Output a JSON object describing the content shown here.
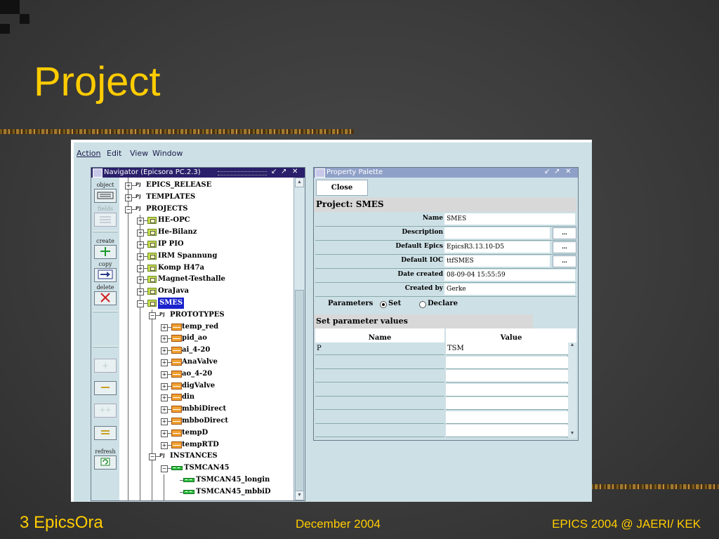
{
  "slide": {
    "title": "Project",
    "footer_left": "3 EpicsOra",
    "footer_center": "December 2004",
    "footer_right": "EPICS 2004 @ JAERI/ KEK"
  },
  "menu": [
    "Action",
    "Edit",
    "View",
    "Window"
  ],
  "navigator": {
    "title": "Navigator  (Epicsora PC.2.3)",
    "toolbar": [
      {
        "label": "object",
        "icon": "object-icon",
        "enabled": true
      },
      {
        "label": "fields",
        "icon": "fields-icon",
        "enabled": false
      },
      {
        "label": "create",
        "icon": "plus-icon",
        "enabled": true
      },
      {
        "label": "copy",
        "icon": "copy-arrow-icon",
        "enabled": true
      },
      {
        "label": "delete",
        "icon": "delete-x-icon",
        "enabled": true
      },
      {
        "label": "",
        "icon": "expand-icon",
        "enabled": false
      },
      {
        "label": "",
        "icon": "collapse-icon",
        "enabled": true
      },
      {
        "label": "",
        "icon": "expand-all-icon",
        "enabled": false
      },
      {
        "label": "",
        "icon": "collapse-all-icon",
        "enabled": true
      },
      {
        "label": "refresh",
        "icon": "refresh-icon",
        "enabled": true
      }
    ],
    "tree": [
      {
        "label": "EPICS_RELEASE",
        "icon": "pj",
        "level": 0,
        "toggle": "+"
      },
      {
        "label": "TEMPLATES",
        "icon": "pj",
        "level": 0,
        "toggle": "+"
      },
      {
        "label": "PROJECTS",
        "icon": "pj",
        "level": 0,
        "toggle": "-"
      },
      {
        "label": "HE-OPC",
        "icon": "project",
        "level": 1,
        "toggle": "+"
      },
      {
        "label": "He-Bilanz",
        "icon": "project",
        "level": 1,
        "toggle": "+"
      },
      {
        "label": "IP PIO",
        "icon": "project",
        "level": 1,
        "toggle": "+"
      },
      {
        "label": "IRM Spannung",
        "icon": "project",
        "level": 1,
        "toggle": "+"
      },
      {
        "label": "Komp H47a",
        "icon": "project",
        "level": 1,
        "toggle": "+"
      },
      {
        "label": "Magnet-Testhalle",
        "icon": "project",
        "level": 1,
        "toggle": "+"
      },
      {
        "label": "OraJava",
        "icon": "project",
        "level": 1,
        "toggle": "+"
      },
      {
        "label": "SMES",
        "icon": "project",
        "level": 1,
        "toggle": "-",
        "selected": true
      },
      {
        "label": "PROTOTYPES",
        "icon": "pj",
        "level": 2,
        "toggle": "-"
      },
      {
        "label": "temp_red",
        "icon": "record",
        "level": 3,
        "toggle": "+"
      },
      {
        "label": "pid_ao",
        "icon": "record",
        "level": 3,
        "toggle": "+"
      },
      {
        "label": "ai_4-20",
        "icon": "record",
        "level": 3,
        "toggle": "+"
      },
      {
        "label": "AnaValve",
        "icon": "record",
        "level": 3,
        "toggle": "+"
      },
      {
        "label": "ao_4-20",
        "icon": "record",
        "level": 3,
        "toggle": "+"
      },
      {
        "label": "digValve",
        "icon": "record",
        "level": 3,
        "toggle": "+"
      },
      {
        "label": "din",
        "icon": "record",
        "level": 3,
        "toggle": "+"
      },
      {
        "label": "mbbiDirect",
        "icon": "record",
        "level": 3,
        "toggle": "+"
      },
      {
        "label": "mbboDirect",
        "icon": "record",
        "level": 3,
        "toggle": "+"
      },
      {
        "label": "tempD",
        "icon": "record",
        "level": 3,
        "toggle": "+"
      },
      {
        "label": "tempRTD",
        "icon": "record",
        "level": 3,
        "toggle": "+"
      },
      {
        "label": "INSTANCES",
        "icon": "pj",
        "level": 2,
        "toggle": "-"
      },
      {
        "label": "TSMCAN45",
        "icon": "instance",
        "level": 3,
        "toggle": "-"
      },
      {
        "label": "TSMCAN45_longin",
        "icon": "instance",
        "level": 4,
        "toggle": ""
      },
      {
        "label": "TSMCAN45_mbbiD",
        "icon": "instance",
        "level": 4,
        "toggle": ""
      }
    ]
  },
  "palette": {
    "title": "Property Palette",
    "close_label": "Close",
    "project_header": "Project:  SMES",
    "properties": [
      {
        "name": "Name",
        "value": "SMES",
        "button": ""
      },
      {
        "name": "Description",
        "value": "",
        "button": "..."
      },
      {
        "name": "Default Epics",
        "value": "EpicsR3.13.10-D5",
        "button": "..."
      },
      {
        "name": "Default IOC",
        "value": "ttfSMES",
        "button": "..."
      },
      {
        "name": "Date created",
        "value": "08-09-04 15:55:59",
        "button": ""
      },
      {
        "name": "Created by",
        "value": "Gerke",
        "button": ""
      }
    ],
    "parameters_label": "Parameters",
    "radio_set": "Set",
    "radio_declare": "Declare",
    "radio_selected": "Set",
    "section_header": "Set parameter values",
    "grid_headers": {
      "name": "Name",
      "value": "Value"
    },
    "grid_rows": [
      {
        "name": "P",
        "value": "TSM"
      },
      {
        "name": "",
        "value": ""
      },
      {
        "name": "",
        "value": ""
      },
      {
        "name": "",
        "value": ""
      },
      {
        "name": "",
        "value": ""
      },
      {
        "name": "",
        "value": ""
      },
      {
        "name": "",
        "value": ""
      }
    ]
  },
  "colors": {
    "title_yellow": "#ffcc00",
    "titlebar_active": "#2a1f6a",
    "selection_blue": "#1a22cc",
    "panel_bg": "#cde0e6"
  }
}
